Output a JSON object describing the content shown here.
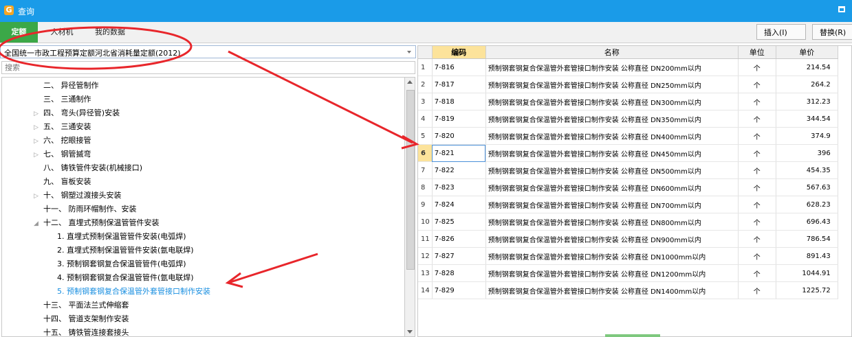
{
  "window": {
    "title": "查询"
  },
  "tabs": [
    {
      "label": "定额",
      "active": true
    },
    {
      "label": "人材机",
      "active": false
    },
    {
      "label": "我的数据",
      "active": false
    }
  ],
  "toolbar": {
    "insert_label": "插入(I)",
    "replace_label": "替换(R)"
  },
  "library": {
    "selected": "全国统一市政工程预算定额河北省消耗量定额(2012)"
  },
  "search": {
    "placeholder": "搜索"
  },
  "tree": [
    {
      "label": "二、 异径管制作",
      "indent": 60,
      "expander": ""
    },
    {
      "label": "三、 三通制作",
      "indent": 60,
      "expander": ""
    },
    {
      "label": "四、 弯头(异径管)安装",
      "indent": 46,
      "expander": "▷"
    },
    {
      "label": "五、 三通安装",
      "indent": 46,
      "expander": "▷"
    },
    {
      "label": "六、 挖眼接管",
      "indent": 46,
      "expander": "▷"
    },
    {
      "label": "七、 钢管摵弯",
      "indent": 46,
      "expander": "▷"
    },
    {
      "label": "八、 铸铁管件安装(机械接口)",
      "indent": 60,
      "expander": ""
    },
    {
      "label": "九、 盲板安装",
      "indent": 60,
      "expander": ""
    },
    {
      "label": "十、 钢塑过渡接头安装",
      "indent": 46,
      "expander": "▷"
    },
    {
      "label": "十一、 防雨环帽制作、安装",
      "indent": 60,
      "expander": ""
    },
    {
      "label": "十二、 直埋式预制保温管管件安装",
      "indent": 46,
      "expander": "◢"
    },
    {
      "label": "1.  直埋式预制保温管管件安装(电弧焊)",
      "indent": 80,
      "expander": ""
    },
    {
      "label": "2.  直埋式预制保温管管件安装(氩电联焊)",
      "indent": 80,
      "expander": ""
    },
    {
      "label": "3.  预制钢套钢复合保温管管件(电弧焊)",
      "indent": 80,
      "expander": ""
    },
    {
      "label": "4.  预制钢套钢复合保温管管件(氩电联焊)",
      "indent": 80,
      "expander": ""
    },
    {
      "label": "5.  预制钢套钢复合保温管外套管接口制作安装",
      "indent": 80,
      "expander": "",
      "selected": true
    },
    {
      "label": "十三、 平面法兰式伸缩套",
      "indent": 60,
      "expander": ""
    },
    {
      "label": "十四、 管道支架制作安装",
      "indent": 60,
      "expander": ""
    },
    {
      "label": "十五、 铸铁管连接套接头",
      "indent": 60,
      "expander": ""
    }
  ],
  "grid": {
    "headers": {
      "code": "编码",
      "name": "名称",
      "unit": "单位",
      "price": "单价"
    },
    "current_row": 6,
    "rows": [
      {
        "no": "1",
        "code": "7-816",
        "name": "预制钢套钢复合保温管外套管接口制作安装 公称直径 DN200mm以内",
        "unit": "个",
        "price": "214.54"
      },
      {
        "no": "2",
        "code": "7-817",
        "name": "预制钢套钢复合保温管外套管接口制作安装 公称直径 DN250mm以内",
        "unit": "个",
        "price": "264.2"
      },
      {
        "no": "3",
        "code": "7-818",
        "name": "预制钢套钢复合保温管外套管接口制作安装 公称直径 DN300mm以内",
        "unit": "个",
        "price": "312.23"
      },
      {
        "no": "4",
        "code": "7-819",
        "name": "预制钢套钢复合保温管外套管接口制作安装 公称直径 DN350mm以内",
        "unit": "个",
        "price": "344.54"
      },
      {
        "no": "5",
        "code": "7-820",
        "name": "预制钢套钢复合保温管外套管接口制作安装 公称直径 DN400mm以内",
        "unit": "个",
        "price": "374.9"
      },
      {
        "no": "6",
        "code": "7-821",
        "name": "预制钢套钢复合保温管外套管接口制作安装 公称直径 DN450mm以内",
        "unit": "个",
        "price": "396"
      },
      {
        "no": "7",
        "code": "7-822",
        "name": "预制钢套钢复合保温管外套管接口制作安装 公称直径 DN500mm以内",
        "unit": "个",
        "price": "454.35"
      },
      {
        "no": "8",
        "code": "7-823",
        "name": "预制钢套钢复合保温管外套管接口制作安装 公称直径 DN600mm以内",
        "unit": "个",
        "price": "567.63"
      },
      {
        "no": "9",
        "code": "7-824",
        "name": "预制钢套钢复合保温管外套管接口制作安装 公称直径 DN700mm以内",
        "unit": "个",
        "price": "628.23"
      },
      {
        "no": "10",
        "code": "7-825",
        "name": "预制钢套钢复合保温管外套管接口制作安装 公称直径 DN800mm以内",
        "unit": "个",
        "price": "696.43"
      },
      {
        "no": "11",
        "code": "7-826",
        "name": "预制钢套钢复合保温管外套管接口制作安装 公称直径 DN900mm以内",
        "unit": "个",
        "price": "786.54"
      },
      {
        "no": "12",
        "code": "7-827",
        "name": "预制钢套钢复合保温管外套管接口制作安装 公称直径 DN1000mm以内",
        "unit": "个",
        "price": "891.43"
      },
      {
        "no": "13",
        "code": "7-828",
        "name": "预制钢套钢复合保温管外套管接口制作安装 公称直径 DN1200mm以内",
        "unit": "个",
        "price": "1044.91"
      },
      {
        "no": "14",
        "code": "7-829",
        "name": "预制钢套钢复合保温管外套管接口制作安装 公称直径 DN1400mm以内",
        "unit": "个",
        "price": "1225.72"
      }
    ]
  },
  "colors": {
    "titlebar": "#1a9be8",
    "active_tab": "#3ba848",
    "header_highlight": "#fce39b",
    "annotation": "#e8262b",
    "selected_tree": "#1a8fe0"
  }
}
